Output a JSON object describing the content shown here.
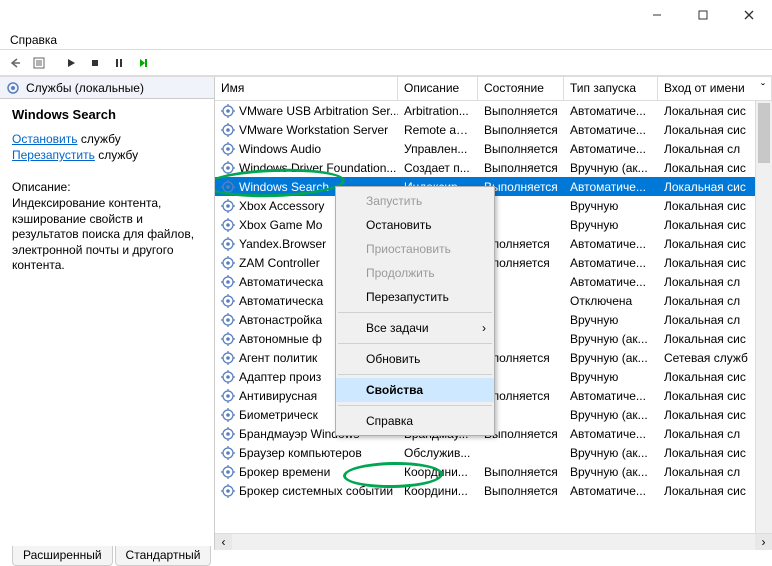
{
  "titlebar": {
    "min": "—",
    "max": "▢",
    "close": "✕"
  },
  "menubar": {
    "help": "Справка"
  },
  "toolbar": {
    "back_icon": "back-icon",
    "props_icon": "properties-icon"
  },
  "category_header": "Службы (локальные)",
  "leftpane": {
    "title": "Windows Search",
    "stop_link": "Остановить",
    "stop_suffix": " службу",
    "restart_link": "Перезапустить",
    "restart_suffix": " службу",
    "desc_header": "Описание:",
    "desc_text": "Индексирование контента, кэширование свойств и результатов поиска для файлов, электронной почты и другого контента."
  },
  "columns": {
    "name": "Имя",
    "desc": "Описание",
    "state": "Состояние",
    "start": "Тип запуска",
    "logon": "Вход от имени"
  },
  "col_caret": "ˇ",
  "services": [
    {
      "name": "VMware USB Arbitration Ser...",
      "desc": "Arbitration...",
      "state": "Выполняется",
      "start": "Автоматиче...",
      "logon": "Локальная сис"
    },
    {
      "name": "VMware Workstation Server",
      "desc": "Remote ac...",
      "state": "Выполняется",
      "start": "Автоматиче...",
      "logon": "Локальная сис"
    },
    {
      "name": "Windows Audio",
      "desc": "Управлен...",
      "state": "Выполняется",
      "start": "Автоматиче...",
      "logon": "Локальная сл"
    },
    {
      "name": "Windows Driver Foundation...",
      "desc": "Создает п...",
      "state": "Выполняется",
      "start": "Вручную (ак...",
      "logon": "Локальная сис"
    },
    {
      "name": "Windows Search",
      "desc": "Индексир...",
      "state": "Выполняется",
      "start": "Автоматиче...",
      "logon": "Локальная сис",
      "selected": true
    },
    {
      "name": "Xbox Accessory",
      "desc": "",
      "state": "",
      "start": "Вручную",
      "logon": "Локальная сис"
    },
    {
      "name": "Xbox Game Mo",
      "desc": "",
      "state": "",
      "start": "Вручную",
      "logon": "Локальная сис"
    },
    {
      "name": "Yandex.Browser",
      "desc": "",
      "state": "ыполняется",
      "start": "Автоматиче...",
      "logon": "Локальная сис"
    },
    {
      "name": "ZAM Controller",
      "desc": "",
      "state": "ыполняется",
      "start": "Автоматиче...",
      "logon": "Локальная сис"
    },
    {
      "name": "Автоматическа",
      "desc": "",
      "state": "",
      "start": "Автоматиче...",
      "logon": "Локальная сл"
    },
    {
      "name": "Автоматическа",
      "desc": "",
      "state": "",
      "start": "Отключена",
      "logon": "Локальная сл"
    },
    {
      "name": "Автонастройка",
      "desc": "",
      "state": "",
      "start": "Вручную",
      "logon": "Локальная сл"
    },
    {
      "name": "Автономные ф",
      "desc": "",
      "state": "",
      "start": "Вручную (ак...",
      "logon": "Локальная сис"
    },
    {
      "name": "Агент политик",
      "desc": "",
      "state": "ыполняется",
      "start": "Вручную (ак...",
      "logon": "Сетевая служб"
    },
    {
      "name": "Адаптер произ",
      "desc": "",
      "state": "",
      "start": "Вручную",
      "logon": "Локальная сис"
    },
    {
      "name": "Антивирусная ",
      "desc": "",
      "state": "ыполняется",
      "start": "Автоматиче...",
      "logon": "Локальная сис"
    },
    {
      "name": "Биометрическ",
      "desc": "",
      "state": "",
      "start": "Вручную (ак...",
      "logon": "Локальная сис"
    },
    {
      "name": "Брандмауэр Windows",
      "desc": "Брандмау...",
      "state": "Выполняется",
      "start": "Автоматиче...",
      "logon": "Локальная сл"
    },
    {
      "name": "Браузер компьютеров",
      "desc": "Обслужив...",
      "state": "",
      "start": "Вручную (ак...",
      "logon": "Локальная сис"
    },
    {
      "name": "Брокер времени",
      "desc": "Координи...",
      "state": "Выполняется",
      "start": "Вручную (ак...",
      "logon": "Локальная сл"
    },
    {
      "name": "Брокер системных событий",
      "desc": "Координи...",
      "state": "Выполняется",
      "start": "Автоматиче...",
      "logon": "Локальная сис"
    }
  ],
  "context_menu": {
    "start": "Запустить",
    "stop": "Остановить",
    "pause": "Приостановить",
    "resume": "Продолжить",
    "restart": "Перезапустить",
    "all_tasks": "Все задачи",
    "refresh": "Обновить",
    "properties": "Свойства",
    "help": "Справка",
    "arrow": "›"
  },
  "tabs": {
    "extended": "Расширенный",
    "standard": "Стандартный"
  }
}
